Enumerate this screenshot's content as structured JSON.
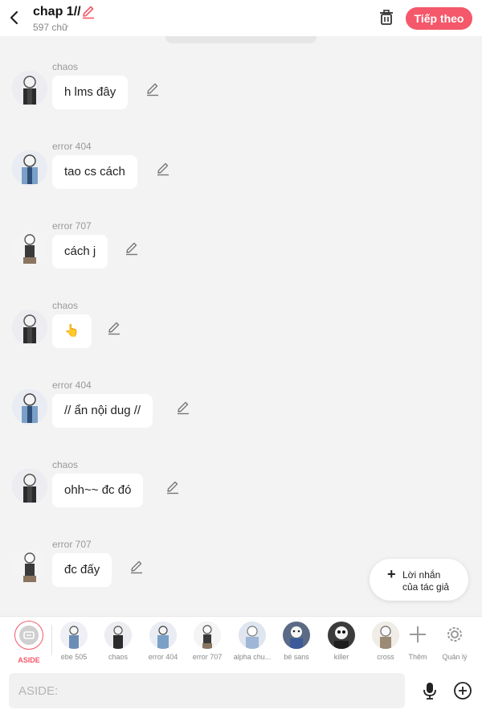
{
  "header": {
    "title": "chap 1//",
    "subtitle": "597 chữ",
    "next_label": "Tiếp theo"
  },
  "messages": [
    {
      "author": "chaos",
      "text": "h lms đây"
    },
    {
      "author": "error 404",
      "text": "tao cs cách"
    },
    {
      "author": "error 707",
      "text": "cách j"
    },
    {
      "author": "chaos",
      "text": "👆"
    },
    {
      "author": "error 404",
      "text": "// ẩn nội dug //"
    },
    {
      "author": "chaos",
      "text": "ohh~~ đc đó"
    },
    {
      "author": "error 707",
      "text": "đc đấy"
    }
  ],
  "author_note": {
    "line1": "Lời nhắn",
    "line2": "của tác giả"
  },
  "characters": {
    "aside": "ASIDE",
    "items": [
      "ebe 505",
      "chaos",
      "error 404",
      "error 707",
      "alpha chu...",
      "bé sans",
      "killer",
      "cross"
    ],
    "add_label": "Thêm",
    "manage_label": "Quản lý"
  },
  "composer": {
    "placeholder": "ASIDE:"
  },
  "colors": {
    "accent": "#f4586a",
    "background": "#f3f3f3"
  }
}
